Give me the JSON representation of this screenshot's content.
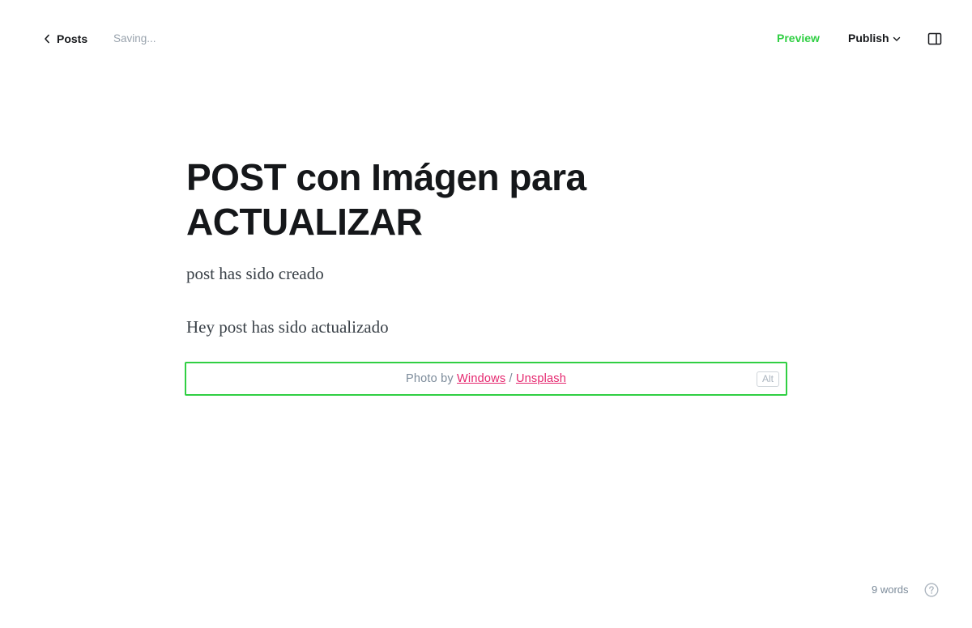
{
  "header": {
    "back_label": "Posts",
    "status": "Saving...",
    "preview_label": "Preview",
    "publish_label": "Publish"
  },
  "post": {
    "title": "POST con Imágen para ACTUALIZAR",
    "excerpt": "post has sido creado",
    "body": "Hey post has sido actualizado"
  },
  "image_card": {
    "caption_prefix": "Photo by ",
    "author": "Windows",
    "separator": " / ",
    "source": "Unsplash",
    "alt_label": "Alt"
  },
  "footer": {
    "word_count": "9 words"
  },
  "colors": {
    "accent": "#30cf43",
    "link": "#e5266e",
    "text": "#15171a",
    "muted": "#99a3ad"
  },
  "icons": {
    "back": "chevron-left-icon",
    "publish_dropdown": "chevron-down-icon",
    "sidebar": "sidebar-panel-icon",
    "help": "question-circle-icon"
  }
}
